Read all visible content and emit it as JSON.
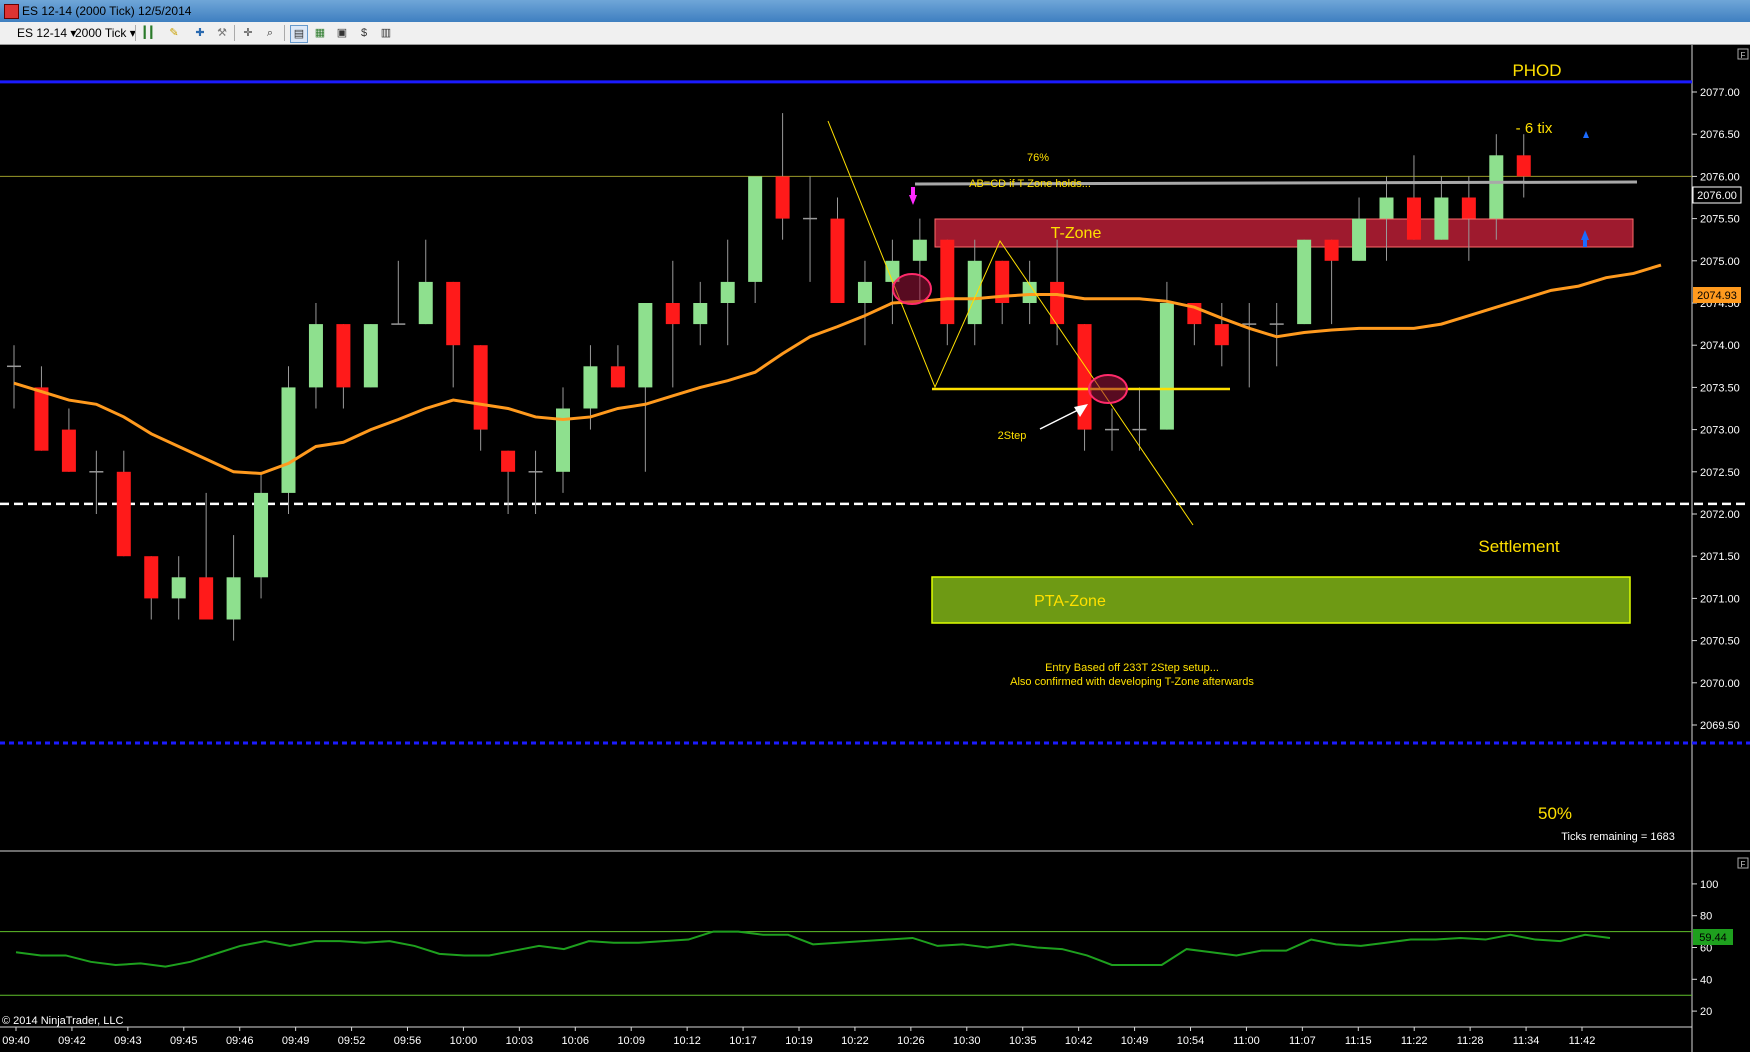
{
  "window": {
    "title": "ES 12-14 (2000 Tick)  12/5/2014"
  },
  "toolbar": {
    "instrument": "ES 12-14",
    "interval": "2000 Tick",
    "icons": [
      "bar-type-icon",
      "pencil-draw-icon",
      "pin-icon",
      "wrench-icon",
      "crosshair-icon",
      "zoom-icon",
      "data-box-icon",
      "chart-trader-icon",
      "screenshot-icon",
      "dollar-icon",
      "properties-icon"
    ]
  },
  "copyright": "© 2014 NinjaTrader, LLC",
  "price_axis": {
    "ticks": [
      "2077.00",
      "2076.50",
      "2076.00",
      "2075.50",
      "2075.00",
      "2074.50",
      "2074.00",
      "2073.50",
      "2073.00",
      "2072.50",
      "2072.00",
      "2071.50",
      "2071.00",
      "2070.50",
      "2070.00",
      "2069.50"
    ],
    "current_price": "2076.00",
    "ema_value": "2074.93"
  },
  "time_axis": [
    "09:40",
    "09:42",
    "09:43",
    "09:45",
    "09:46",
    "09:49",
    "09:52",
    "09:56",
    "10:00",
    "10:03",
    "10:06",
    "10:09",
    "10:12",
    "10:17",
    "10:19",
    "10:22",
    "10:26",
    "10:30",
    "10:35",
    "10:42",
    "10:49",
    "10:54",
    "11:00",
    "11:07",
    "11:15",
    "11:22",
    "11:28",
    "11:34",
    "11:42"
  ],
  "annotations": {
    "phod": "PHOD",
    "six_tix": "- 6 tix",
    "pct76": "76%",
    "abcd": "AB=CD if T-Zone holds...",
    "tzone": "T-Zone",
    "twostep": "2Step",
    "settlement": "Settlement",
    "pta_zone": "PTA-Zone",
    "entry_line1": "Entry Based off 233T 2Step setup...",
    "entry_line2": "Also confirmed with developing T-Zone afterwards",
    "fifty_pct": "50%",
    "ticks_remaining": "Ticks remaining = 1683"
  },
  "indicator_panel": {
    "ticks": [
      "100",
      "80",
      "60",
      "40",
      "20"
    ],
    "current_value": "59.44",
    "upper_level": 70,
    "lower_level": 30,
    "values": [
      57,
      55,
      55,
      51,
      49,
      50,
      48,
      51,
      56,
      61,
      64,
      61,
      64,
      64,
      63,
      64,
      61,
      56,
      55,
      55,
      58,
      61,
      59,
      64,
      63,
      63,
      64,
      65,
      70,
      70,
      68,
      68,
      62,
      63,
      64,
      65,
      66,
      61,
      62,
      60,
      62,
      60,
      59,
      55,
      49,
      49,
      49,
      59,
      57,
      55,
      58,
      58,
      65,
      62,
      61,
      63,
      65,
      65,
      66,
      65,
      68,
      65,
      64,
      68,
      66
    ]
  },
  "colors": {
    "up": "#8ee08e",
    "down": "#ff1a1a",
    "ema": "#ff9a1e",
    "phod_line": "#1b1bff",
    "annotation": "#ffe000",
    "tzone_fill": "#9e1a2e",
    "pta_fill": "#6e9a14",
    "indicator": "#1ea01e",
    "axis_bg": "#000000"
  },
  "chart_data": {
    "type": "candlestick",
    "y_range": [
      2069.25,
      2077.5
    ],
    "indicator_range": [
      10,
      110
    ],
    "levels": {
      "phod": 2077.12,
      "settlement": 2072.12,
      "fifty_pct": 2069.25,
      "current": 2076.0
    },
    "ema": [
      2073.55,
      2073.45,
      2073.35,
      2073.3,
      2073.15,
      2072.95,
      2072.8,
      2072.65,
      2072.5,
      2072.48,
      2072.6,
      2072.8,
      2072.85,
      2073.0,
      2073.12,
      2073.25,
      2073.35,
      2073.3,
      2073.25,
      2073.15,
      2073.12,
      2073.15,
      2073.25,
      2073.3,
      2073.4,
      2073.5,
      2073.58,
      2073.68,
      2073.9,
      2074.1,
      2074.22,
      2074.35,
      2074.5,
      2074.52,
      2074.55,
      2074.55,
      2074.58,
      2074.6,
      2074.6,
      2074.55,
      2074.55,
      2074.55,
      2074.52,
      2074.45,
      2074.32,
      2074.2,
      2074.1,
      2074.15,
      2074.18,
      2074.2,
      2074.2,
      2074.2,
      2074.25,
      2074.35,
      2074.45,
      2074.55,
      2074.65,
      2074.7,
      2074.8,
      2074.85,
      2074.95
    ],
    "candles": [
      {
        "o": 2073.75,
        "h": 2074.0,
        "l": 2073.25,
        "c": 2073.75
      },
      {
        "o": 2073.5,
        "h": 2073.75,
        "l": 2072.75,
        "c": 2072.75
      },
      {
        "o": 2073.0,
        "h": 2073.25,
        "l": 2072.5,
        "c": 2072.5
      },
      {
        "o": 2072.5,
        "h": 2072.75,
        "l": 2072.0,
        "c": 2072.5
      },
      {
        "o": 2072.5,
        "h": 2072.75,
        "l": 2071.5,
        "c": 2071.5
      },
      {
        "o": 2071.5,
        "h": 2071.5,
        "l": 2070.75,
        "c": 2071.0
      },
      {
        "o": 2071.0,
        "h": 2071.5,
        "l": 2070.75,
        "c": 2071.25
      },
      {
        "o": 2071.25,
        "h": 2072.25,
        "l": 2070.75,
        "c": 2070.75
      },
      {
        "o": 2070.75,
        "h": 2071.75,
        "l": 2070.5,
        "c": 2071.25
      },
      {
        "o": 2071.25,
        "h": 2072.5,
        "l": 2071.0,
        "c": 2072.25
      },
      {
        "o": 2072.25,
        "h": 2073.75,
        "l": 2072.0,
        "c": 2073.5
      },
      {
        "o": 2073.5,
        "h": 2074.5,
        "l": 2073.25,
        "c": 2074.25
      },
      {
        "o": 2074.25,
        "h": 2074.25,
        "l": 2073.25,
        "c": 2073.5
      },
      {
        "o": 2073.5,
        "h": 2074.25,
        "l": 2073.5,
        "c": 2074.25
      },
      {
        "o": 2074.25,
        "h": 2075.0,
        "l": 2074.25,
        "c": 2074.25
      },
      {
        "o": 2074.25,
        "h": 2075.25,
        "l": 2074.25,
        "c": 2074.75
      },
      {
        "o": 2074.75,
        "h": 2074.75,
        "l": 2073.5,
        "c": 2074.0
      },
      {
        "o": 2074.0,
        "h": 2074.0,
        "l": 2072.75,
        "c": 2073.0
      },
      {
        "o": 2072.75,
        "h": 2072.75,
        "l": 2072.0,
        "c": 2072.5
      },
      {
        "o": 2072.5,
        "h": 2072.75,
        "l": 2072.0,
        "c": 2072.5
      },
      {
        "o": 2072.5,
        "h": 2073.5,
        "l": 2072.25,
        "c": 2073.25
      },
      {
        "o": 2073.25,
        "h": 2074.0,
        "l": 2073.0,
        "c": 2073.75
      },
      {
        "o": 2073.75,
        "h": 2074.0,
        "l": 2073.5,
        "c": 2073.5
      },
      {
        "o": 2073.5,
        "h": 2074.5,
        "l": 2072.5,
        "c": 2074.5
      },
      {
        "o": 2074.5,
        "h": 2075.0,
        "l": 2073.5,
        "c": 2074.25
      },
      {
        "o": 2074.25,
        "h": 2074.75,
        "l": 2074.0,
        "c": 2074.5
      },
      {
        "o": 2074.5,
        "h": 2075.25,
        "l": 2074.0,
        "c": 2074.75
      },
      {
        "o": 2074.75,
        "h": 2075.75,
        "l": 2074.5,
        "c": 2076.0
      },
      {
        "o": 2076.0,
        "h": 2076.75,
        "l": 2075.25,
        "c": 2075.5
      },
      {
        "o": 2075.5,
        "h": 2076.0,
        "l": 2074.75,
        "c": 2075.5
      },
      {
        "o": 2075.5,
        "h": 2075.75,
        "l": 2074.5,
        "c": 2074.5
      },
      {
        "o": 2074.5,
        "h": 2075.0,
        "l": 2074.0,
        "c": 2074.75
      },
      {
        "o": 2074.75,
        "h": 2075.25,
        "l": 2074.25,
        "c": 2075.0
      },
      {
        "o": 2075.0,
        "h": 2075.5,
        "l": 2074.5,
        "c": 2075.25
      },
      {
        "o": 2075.25,
        "h": 2075.25,
        "l": 2074.0,
        "c": 2074.25
      },
      {
        "o": 2074.25,
        "h": 2075.25,
        "l": 2074.0,
        "c": 2075.0
      },
      {
        "o": 2075.0,
        "h": 2075.0,
        "l": 2074.25,
        "c": 2074.5
      },
      {
        "o": 2074.5,
        "h": 2075.0,
        "l": 2074.25,
        "c": 2074.75
      },
      {
        "o": 2074.75,
        "h": 2075.25,
        "l": 2074.0,
        "c": 2074.25
      },
      {
        "o": 2074.25,
        "h": 2074.25,
        "l": 2072.75,
        "c": 2073.0
      },
      {
        "o": 2073.0,
        "h": 2073.25,
        "l": 2072.75,
        "c": 2073.0
      },
      {
        "o": 2073.0,
        "h": 2073.5,
        "l": 2072.75,
        "c": 2073.0
      },
      {
        "o": 2073.0,
        "h": 2074.75,
        "l": 2073.0,
        "c": 2074.5
      },
      {
        "o": 2074.5,
        "h": 2074.5,
        "l": 2074.0,
        "c": 2074.25
      },
      {
        "o": 2074.25,
        "h": 2074.5,
        "l": 2073.75,
        "c": 2074.0
      },
      {
        "o": 2074.25,
        "h": 2074.5,
        "l": 2073.5,
        "c": 2074.25
      },
      {
        "o": 2074.25,
        "h": 2074.5,
        "l": 2073.75,
        "c": 2074.25
      },
      {
        "o": 2074.25,
        "h": 2075.25,
        "l": 2074.25,
        "c": 2075.25
      },
      {
        "o": 2075.25,
        "h": 2075.25,
        "l": 2074.25,
        "c": 2075.0
      },
      {
        "o": 2075.0,
        "h": 2075.75,
        "l": 2075.0,
        "c": 2075.5
      },
      {
        "o": 2075.5,
        "h": 2076.0,
        "l": 2075.0,
        "c": 2075.75
      },
      {
        "o": 2075.75,
        "h": 2076.25,
        "l": 2075.25,
        "c": 2075.25
      },
      {
        "o": 2075.25,
        "h": 2076.0,
        "l": 2075.25,
        "c": 2075.75
      },
      {
        "o": 2075.75,
        "h": 2076.0,
        "l": 2075.0,
        "c": 2075.5
      },
      {
        "o": 2075.5,
        "h": 2076.5,
        "l": 2075.25,
        "c": 2076.25
      },
      {
        "o": 2076.25,
        "h": 2076.5,
        "l": 2075.75,
        "c": 2076.0
      }
    ]
  }
}
